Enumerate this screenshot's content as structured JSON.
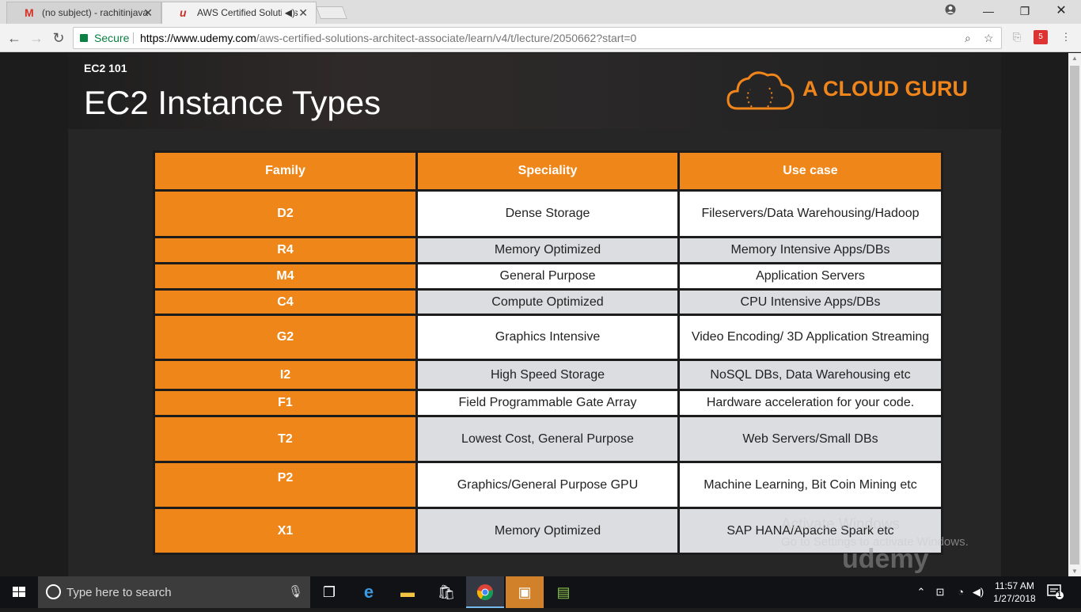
{
  "browser": {
    "tabs": [
      {
        "title": "(no subject) - rachitinjava",
        "favicon": "gmail-icon"
      },
      {
        "title": "AWS Certified Solutions",
        "favicon": "udemy-icon"
      }
    ],
    "security_label": "Secure",
    "url_domain": "https://www.udemy.com",
    "url_path": "/aws-certified-solutions-architect-associate/learn/v4/t/lecture/2050662?start=0",
    "extension_badge": "5"
  },
  "slide": {
    "kicker": "EC2 101",
    "title": "EC2 Instance Types",
    "brand": "A CLOUD GURU",
    "headers": [
      "Family",
      "Speciality",
      "Use case"
    ],
    "rows": [
      {
        "family": "D2",
        "speciality": "Dense Storage",
        "use_case": "Fileservers/Data Warehousing/Hadoop"
      },
      {
        "family": "R4",
        "speciality": "Memory Optimized",
        "use_case": "Memory Intensive Apps/DBs"
      },
      {
        "family": "M4",
        "speciality": "General Purpose",
        "use_case": "Application Servers"
      },
      {
        "family": "C4",
        "speciality": "Compute Optimized",
        "use_case": "CPU Intensive Apps/DBs"
      },
      {
        "family": "G2",
        "speciality": "Graphics Intensive",
        "use_case": "Video Encoding/ 3D Application Streaming"
      },
      {
        "family": "I2",
        "speciality": "High Speed Storage",
        "use_case": "NoSQL DBs, Data Warehousing etc"
      },
      {
        "family": "F1",
        "speciality": "Field Programmable Gate Array",
        "use_case": "Hardware acceleration for your code."
      },
      {
        "family": "T2",
        "speciality": "Lowest Cost, General Purpose",
        "use_case": "Web Servers/Small DBs"
      },
      {
        "family": "P2",
        "speciality": "Graphics/General Purpose GPU",
        "use_case": "Machine Learning, Bit Coin Mining etc"
      },
      {
        "family": "X1",
        "speciality": "Memory Optimized",
        "use_case": "SAP HANA/Apache Spark etc"
      }
    ]
  },
  "watermark": {
    "line1": "Activate Windows",
    "line2": "Go to Settings to activate Windows.",
    "brand": "udemy"
  },
  "taskbar": {
    "search_placeholder": "Type here to search",
    "time": "11:57 AM",
    "date": "1/27/2018",
    "notification_count": "1"
  },
  "colors": {
    "accent_orange": "#ee8619",
    "secure_green": "#0b8043",
    "row_alt": "#dcdde0"
  }
}
